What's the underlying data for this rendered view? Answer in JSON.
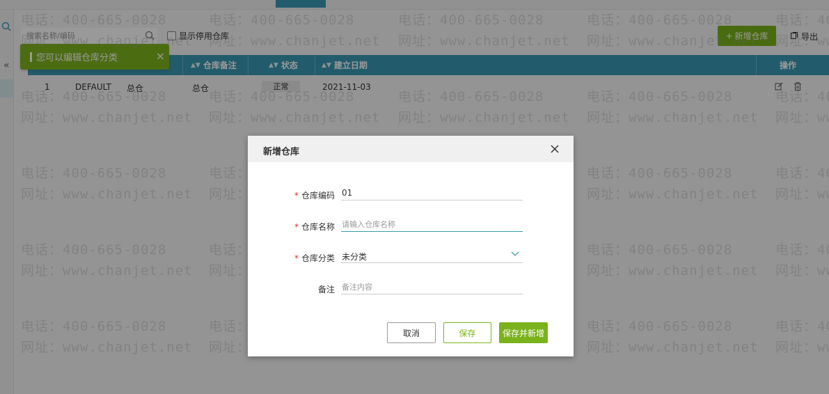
{
  "search": {
    "placeholder": "搜索名称/编码"
  },
  "filter": {
    "show_disabled_label": "显示停用仓库"
  },
  "toolbar": {
    "add_label": "新增仓库",
    "export_label": "导出"
  },
  "toast": {
    "message": "您可以编辑仓库分类"
  },
  "table": {
    "headers": {
      "note": "仓库备注",
      "status": "状态",
      "created": "建立日期",
      "actions": "操作"
    },
    "rows": [
      {
        "index": "1",
        "code": "DEFAULT",
        "name": "总仓",
        "note": "总仓",
        "status": "正常",
        "created": "2021-11-03"
      }
    ]
  },
  "modal": {
    "title": "新增仓库",
    "fields": {
      "code_label": "仓库编码",
      "code_value": "01",
      "name_label": "仓库名称",
      "name_placeholder": "请输入仓库名称",
      "category_label": "仓库分类",
      "category_value": "未分类",
      "remark_label": "备注",
      "remark_placeholder": "备注内容"
    },
    "buttons": {
      "cancel": "取消",
      "save": "保存",
      "save_new": "保存并新增"
    }
  },
  "watermark": {
    "phone": "电话：400-665-0028",
    "site": "网址：www.chanjet.net"
  },
  "colors": {
    "accent": "#3a9ab4",
    "brand_green": "#7ab21b",
    "required": "#e0301e"
  }
}
